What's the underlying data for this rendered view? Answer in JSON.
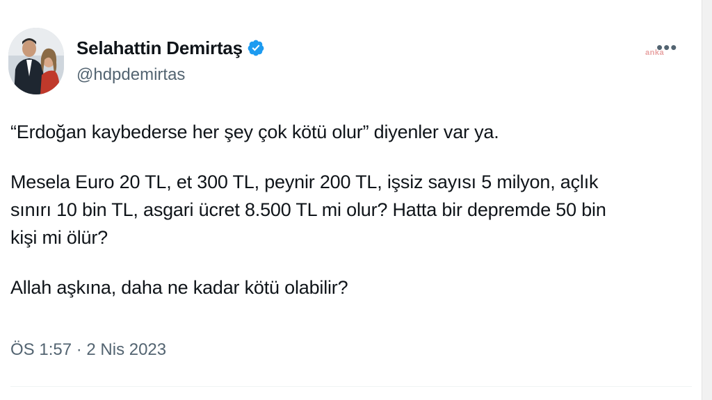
{
  "author": {
    "display_name": "Selahattin Demirtaş",
    "handle": "@hdpdemirtas",
    "verified_color": "#1d9bf0"
  },
  "menu": {
    "more_label": "•••"
  },
  "watermark": {
    "text": "anka"
  },
  "tweet": {
    "paragraphs": [
      "“Erdoğan kaybederse her şey çok kötü olur” diyenler var ya.",
      "Mesela Euro 20 TL, et 300 TL, peynir 200 TL, işsiz sayısı 5 milyon, açlık\nsınırı 10 bin TL, asgari ücret 8.500 TL mi olur? Hatta bir depremde 50 bin\nkişi mi ölür?",
      "Allah aşkına, daha ne kadar kötü olabilir?"
    ],
    "timestamp": "ÖS 1:57 · 2 Nis 2023"
  }
}
